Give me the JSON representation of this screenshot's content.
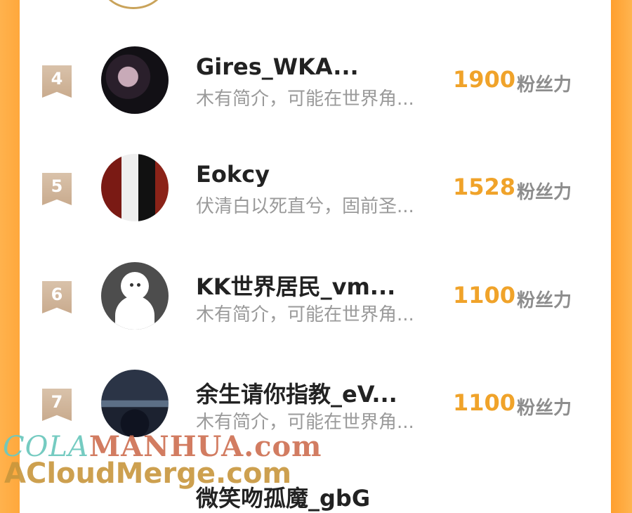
{
  "unit_label": "粉丝力",
  "rows": [
    {
      "rank": "4",
      "name": "Gires_WKA...",
      "desc": "木有简介，可能在世界角...",
      "score": "1900"
    },
    {
      "rank": "5",
      "name": "Eokcy",
      "desc": "伏清白以死直兮，固前圣...",
      "score": "1528"
    },
    {
      "rank": "6",
      "name": "KK世界居民_vm...",
      "desc": "木有简介，可能在世界角...",
      "score": "1100"
    },
    {
      "rank": "7",
      "name": "余生请你指教_eV...",
      "desc": "木有简介，可能在世界角...",
      "score": "1100"
    }
  ],
  "partial_row": {
    "name": "微笑吻孤魔_gbG"
  },
  "watermark": {
    "line1_a": "COLA",
    "line1_b": "MANHUA.com",
    "line2": "ACloudMerge.com"
  },
  "colors": {
    "score": "#f0a32a",
    "rank_badge": "#d2b79c",
    "side": "#ffa83c"
  }
}
